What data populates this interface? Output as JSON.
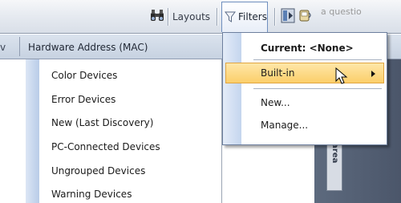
{
  "toolbar": {
    "layouts_label": "Layouts",
    "filters_label": "Filters",
    "question_text": "a questio",
    "icons": [
      "binoculars-icon",
      "filter-funnel-icon",
      "layout-toggle-icon",
      "chat-device-icon"
    ]
  },
  "grid": {
    "header_left": "v",
    "header_mac": "Hardware Address (MAC)",
    "side_hint": "ing area"
  },
  "filters_menu": {
    "current": "Current: <None>",
    "builtin": "Built-in",
    "new": "New...",
    "manage": "Manage..."
  },
  "builtin_submenu": {
    "items": [
      "Color Devices",
      "Error Devices",
      "New (Last Discovery)",
      "PC-Connected Devices",
      "Ungrouped Devices",
      "Warning Devices"
    ]
  },
  "colors": {
    "highlight": "#fbcf6a",
    "menu_border": "#6d7f9e",
    "dark_area": "#4b566a"
  }
}
